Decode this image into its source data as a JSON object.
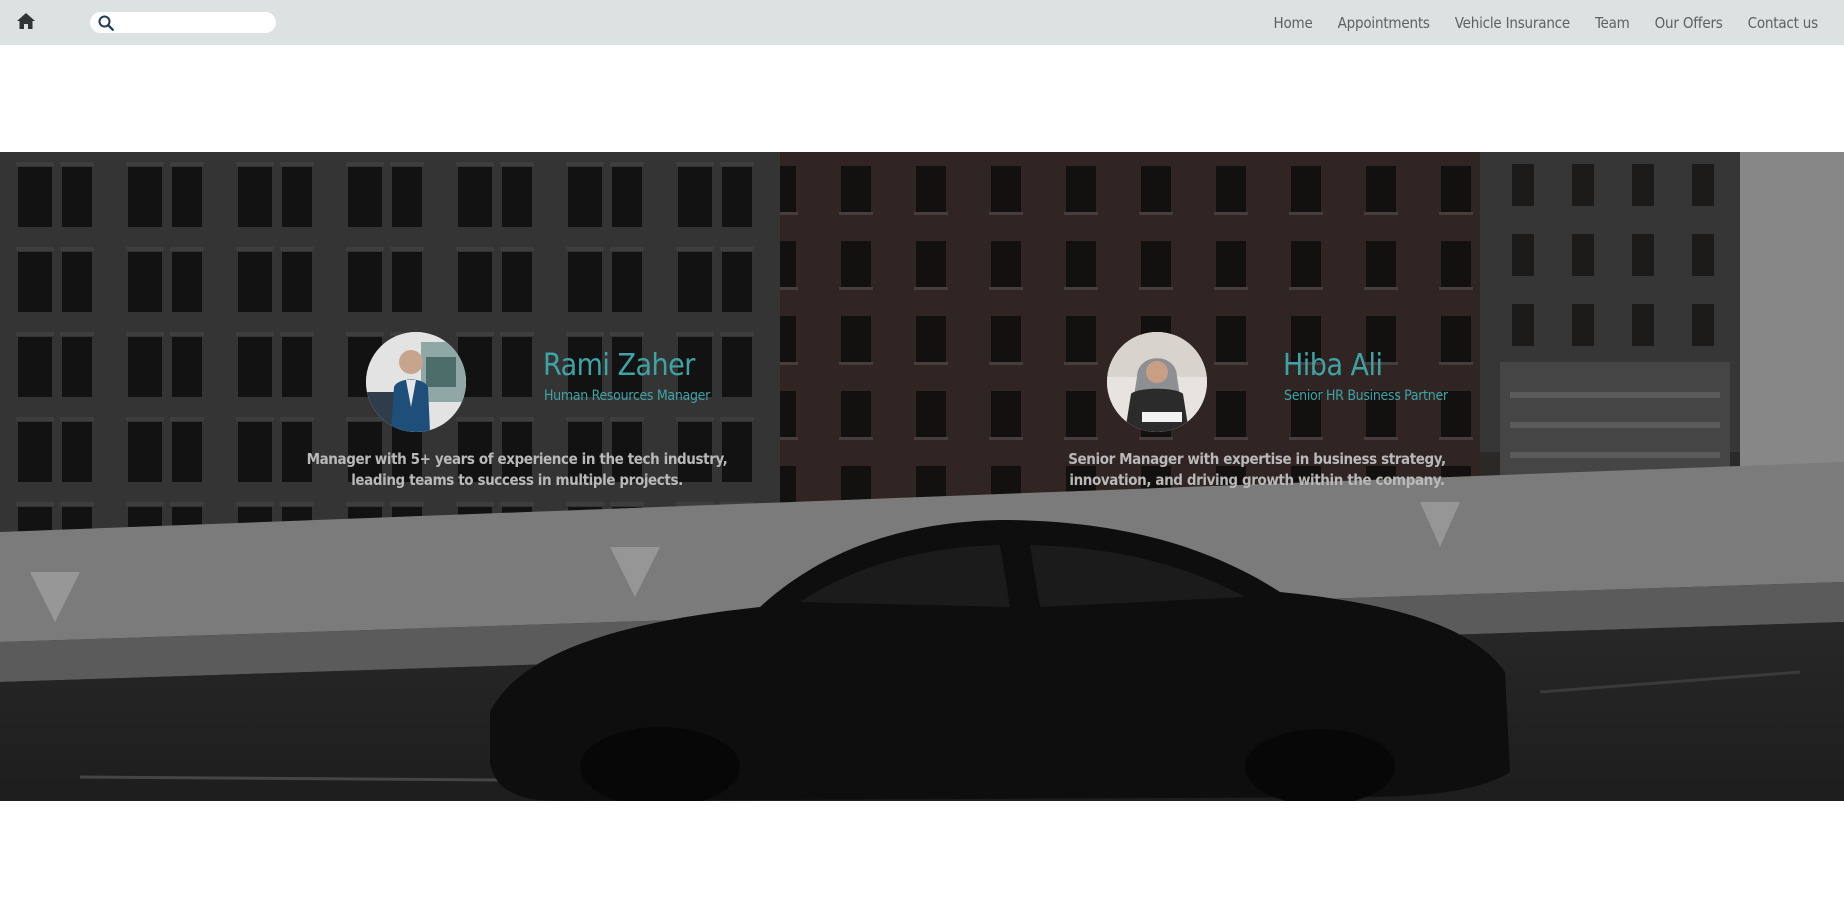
{
  "nav": {
    "home_icon": "home-icon",
    "search": {
      "icon": "search-icon",
      "placeholder": "",
      "value": ""
    },
    "links": [
      "Home",
      "Appointments",
      "Vehicle Insurance",
      "Team",
      "Our Offers",
      "Contact us"
    ]
  },
  "team": {
    "members": [
      {
        "name": "Rami Zaher",
        "role": "Human Resources Manager",
        "bio": "Manager with 5+ years of experience in the tech industry, leading teams to success in multiple projects."
      },
      {
        "name": "Hiba Ali",
        "role": "Senior HR Business Partner",
        "bio": "Senior Manager with expertise in business strategy, innovation, and driving growth within the company."
      }
    ]
  },
  "colors": {
    "navbar": "#dce1e1",
    "accent": "#3fa3a6",
    "nav_text": "#5d6163",
    "bio_text": "#b9b9b9"
  }
}
